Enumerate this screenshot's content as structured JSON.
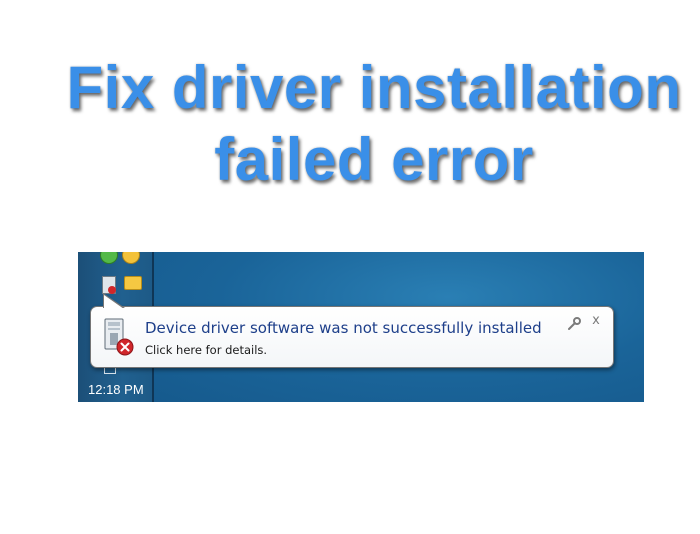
{
  "headline": {
    "line1": "Fix driver installation",
    "line2": "failed error",
    "color": "#3a8fe8"
  },
  "notification": {
    "title": "Device driver software was not successfully installed",
    "subtitle": "Click here for details.",
    "icon": "device-error-icon",
    "options_icon": "wrench-icon",
    "close_glyph": "x",
    "title_color": "#1e3f8a"
  },
  "taskbar": {
    "clock": "12:18 PM",
    "tray_icons": [
      "green-shield-icon",
      "yellow-icon",
      "device-warning-icon",
      "chat-icon",
      "network-icon"
    ]
  },
  "colors": {
    "desktop": "#1a6499",
    "error_red": "#d0262a"
  }
}
